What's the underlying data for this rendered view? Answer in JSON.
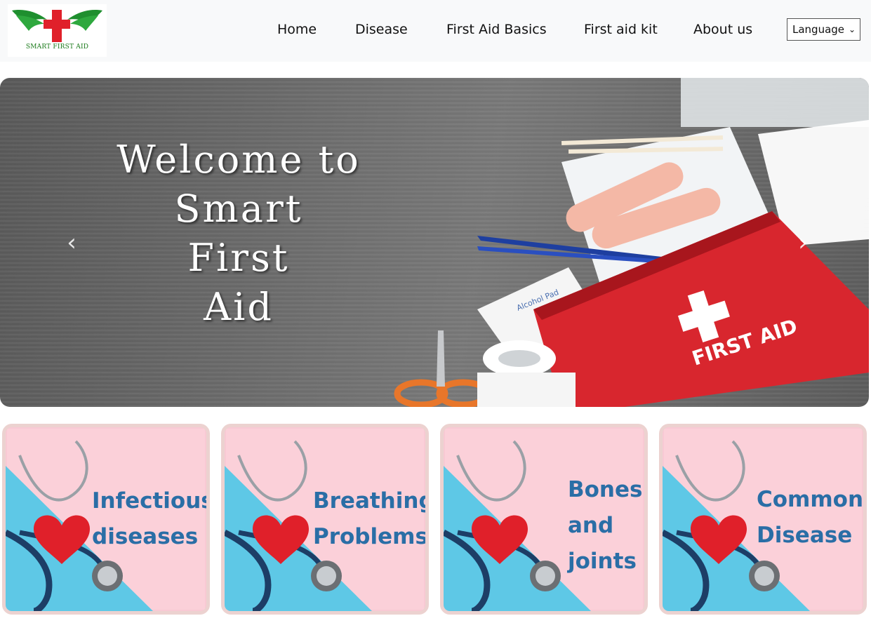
{
  "header": {
    "logo_text": "SMART FIRST AID",
    "nav": [
      {
        "label": "Home"
      },
      {
        "label": "Disease"
      },
      {
        "label": "First Aid Basics"
      },
      {
        "label": "First aid kit"
      },
      {
        "label": "About us"
      }
    ],
    "language_select": {
      "selected": "Language"
    }
  },
  "hero": {
    "title_lines": [
      "Welcome to",
      "Smart",
      "First",
      "Aid"
    ],
    "kit_label": "FIRST AID",
    "pad_label": "Alcohol Pad",
    "prev_glyph": "‹",
    "next_glyph": "›"
  },
  "cards": [
    {
      "title_lines": [
        "Infectious",
        "diseases"
      ]
    },
    {
      "title_lines": [
        "Breathing",
        "Problems"
      ]
    },
    {
      "title_lines": [
        "Bones",
        "and",
        "joints"
      ]
    },
    {
      "title_lines": [
        "Common",
        "Disease"
      ]
    }
  ],
  "colors": {
    "navbar_bg": "#f8f9fa",
    "card_title": "#2a6ea6",
    "card_bg": "#fbd0d9",
    "card_border": "#ecd2d0",
    "logo_cross": "#e0202a",
    "logo_wings": "#1f8f2f"
  }
}
